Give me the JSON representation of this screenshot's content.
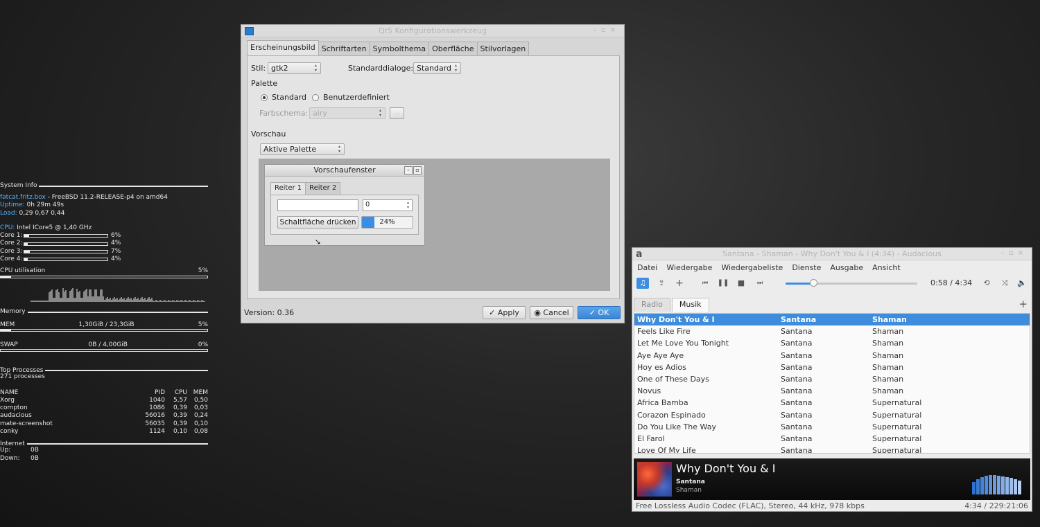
{
  "conky": {
    "system_header": "System Info",
    "hostname": "fatcat.fritz.box",
    "os": " - FreeBSD 11.2-RELEASE-p4 on amd64",
    "uptime_label": "Uptime:",
    "uptime_value": " 0h 29m 49s",
    "load_label": "Load:",
    "load_value": " 0,29 0,67 0,44",
    "cpu_label": "CPU:",
    "cpu_value": " Intel ICore5 @ 1,40 GHz",
    "cores": [
      {
        "label": "Core 1:",
        "value": "6%",
        "fraction": 0.06
      },
      {
        "label": "Core 2:",
        "value": "4%",
        "fraction": 0.04
      },
      {
        "label": "Core 3:",
        "value": "7%",
        "fraction": 0.07
      },
      {
        "label": "Core 4:",
        "value": "4%",
        "fraction": 0.04
      }
    ],
    "cpu_util_label": "CPU utilisation",
    "cpu_util_value": "5%",
    "cpu_util_fraction": 0.05,
    "memory_header": "Memory",
    "mem_label": "MEM",
    "mem_value": "1,30GiB / 23,3GiB",
    "mem_percent": "5%",
    "mem_fraction": 0.05,
    "swap_label": "SWAP",
    "swap_value": "0B   / 4,00GiB",
    "swap_percent": "0%",
    "swap_fraction": 0.0,
    "processes_header": "Top Processes",
    "processes_count": "271 processes",
    "proc_columns": [
      "NAME",
      "PID",
      "CPU",
      "MEM"
    ],
    "processes": [
      [
        "Xorg",
        "1040",
        "5,57",
        "0,50"
      ],
      [
        "compton",
        "1086",
        "0,39",
        "0,03"
      ],
      [
        "audacious",
        "56016",
        "0,39",
        "0,24"
      ],
      [
        "mate-screenshot",
        "56035",
        "0,39",
        "0,10"
      ],
      [
        "conky",
        "1124",
        "0,10",
        "0,08"
      ]
    ],
    "internet_header": "Internet",
    "up_label": "Up:",
    "up_value": "0B",
    "down_label": "Down:",
    "down_value": "0B"
  },
  "qt": {
    "title": "Qt5 Konfigurationswerkzeug",
    "tabs": [
      "Erscheinungsbild",
      "Schriftarten",
      "Symbolthema",
      "Oberfläche",
      "Stilvorlagen"
    ],
    "stil_label": "Stil:",
    "stil_value": "gtk2",
    "dialogs_label": "Standarddialoge:",
    "dialogs_value": "Standard",
    "palette_label": "Palette",
    "radio_standard": "Standard",
    "radio_custom": "Benutzerdefiniert",
    "farbschema_label": "Farbschema:",
    "farbschema_value": "airy",
    "farbschema_more": "...",
    "vorschau_label": "Vorschau",
    "vorschau_value": "Aktive Palette",
    "preview_window_title": "Vorschaufenster",
    "preview_tabs": [
      "Reiter 1",
      "Reiter 2"
    ],
    "preview_spin_value": "0",
    "preview_button": "Schaltfläche drücken",
    "preview_progress": "24%",
    "preview_progress_fraction": 0.24,
    "version": "Version: 0.36",
    "apply": "Apply",
    "cancel": "Cancel",
    "ok": "OK"
  },
  "audacious": {
    "title": "Santana - Shaman - Why Don't You & I (4:34) - Audacious",
    "menu": [
      "Datei",
      "Wiedergabe",
      "Wiedergabeliste",
      "Dienste",
      "Ausgabe",
      "Ansicht"
    ],
    "time": "0:58 / 4:34",
    "seek_fraction": 0.21,
    "tabs": [
      "Radio",
      "Musik"
    ],
    "add_tab": "+",
    "playlist": [
      [
        "Why Don't You & I",
        "Santana",
        "Shaman"
      ],
      [
        "Feels Like Fire",
        "Santana",
        "Shaman"
      ],
      [
        "Let Me Love You Tonight",
        "Santana",
        "Shaman"
      ],
      [
        "Aye Aye Aye",
        "Santana",
        "Shaman"
      ],
      [
        "Hoy es Adios",
        "Santana",
        "Shaman"
      ],
      [
        "One of These Days",
        "Santana",
        "Shaman"
      ],
      [
        "Novus",
        "Santana",
        "Shaman"
      ],
      [
        "Africa Bamba",
        "Santana",
        "Supernatural"
      ],
      [
        "Corazon Espinado",
        "Santana",
        "Supernatural"
      ],
      [
        "Do You Like The Way",
        "Santana",
        "Supernatural"
      ],
      [
        "El Farol",
        "Santana",
        "Supernatural"
      ],
      [
        "Love Of My Life",
        "Santana",
        "Supernatural"
      ]
    ],
    "now_title": "Why Don't You & I",
    "now_artist": "Santana",
    "now_album": "Shaman",
    "codec_info": "Free Lossless Audio Codec (FLAC), Stereo, 44 kHz, 978 kbps",
    "total_time": "4:34 / 229:21:06",
    "accent": "#3e8ddd"
  }
}
